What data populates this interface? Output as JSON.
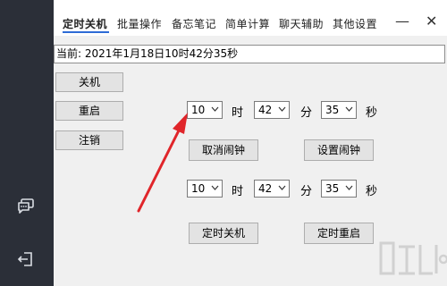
{
  "sidebar": {
    "icons": [
      "chat-icon",
      "logout-icon"
    ]
  },
  "tabs": [
    {
      "label": "定时关机",
      "active": true
    },
    {
      "label": "批量操作"
    },
    {
      "label": "备忘笔记"
    },
    {
      "label": "简单计算"
    },
    {
      "label": "聊天辅助"
    },
    {
      "label": "其他设置"
    }
  ],
  "window": {
    "minimize": "—",
    "close": "✕"
  },
  "current_time": "当前: 2021年1月18日10时42分35秒",
  "actions": {
    "shutdown": "关机",
    "restart": "重启",
    "logoff": "注销"
  },
  "alarm": {
    "hour": "10",
    "minute": "42",
    "second": "35",
    "hour_unit": "时",
    "minute_unit": "分",
    "second_unit": "秒",
    "cancel_label": "取消闹钟",
    "set_label": "设置闹钟"
  },
  "timer": {
    "hour": "10",
    "minute": "42",
    "second": "35",
    "hour_unit": "时",
    "minute_unit": "分",
    "second_unit": "秒",
    "shutdown_label": "定时关机",
    "restart_label": "定时重启"
  },
  "colors": {
    "sidebar": "#2b2f38",
    "accent": "#2d6bd6",
    "arrow": "#e0252a"
  }
}
